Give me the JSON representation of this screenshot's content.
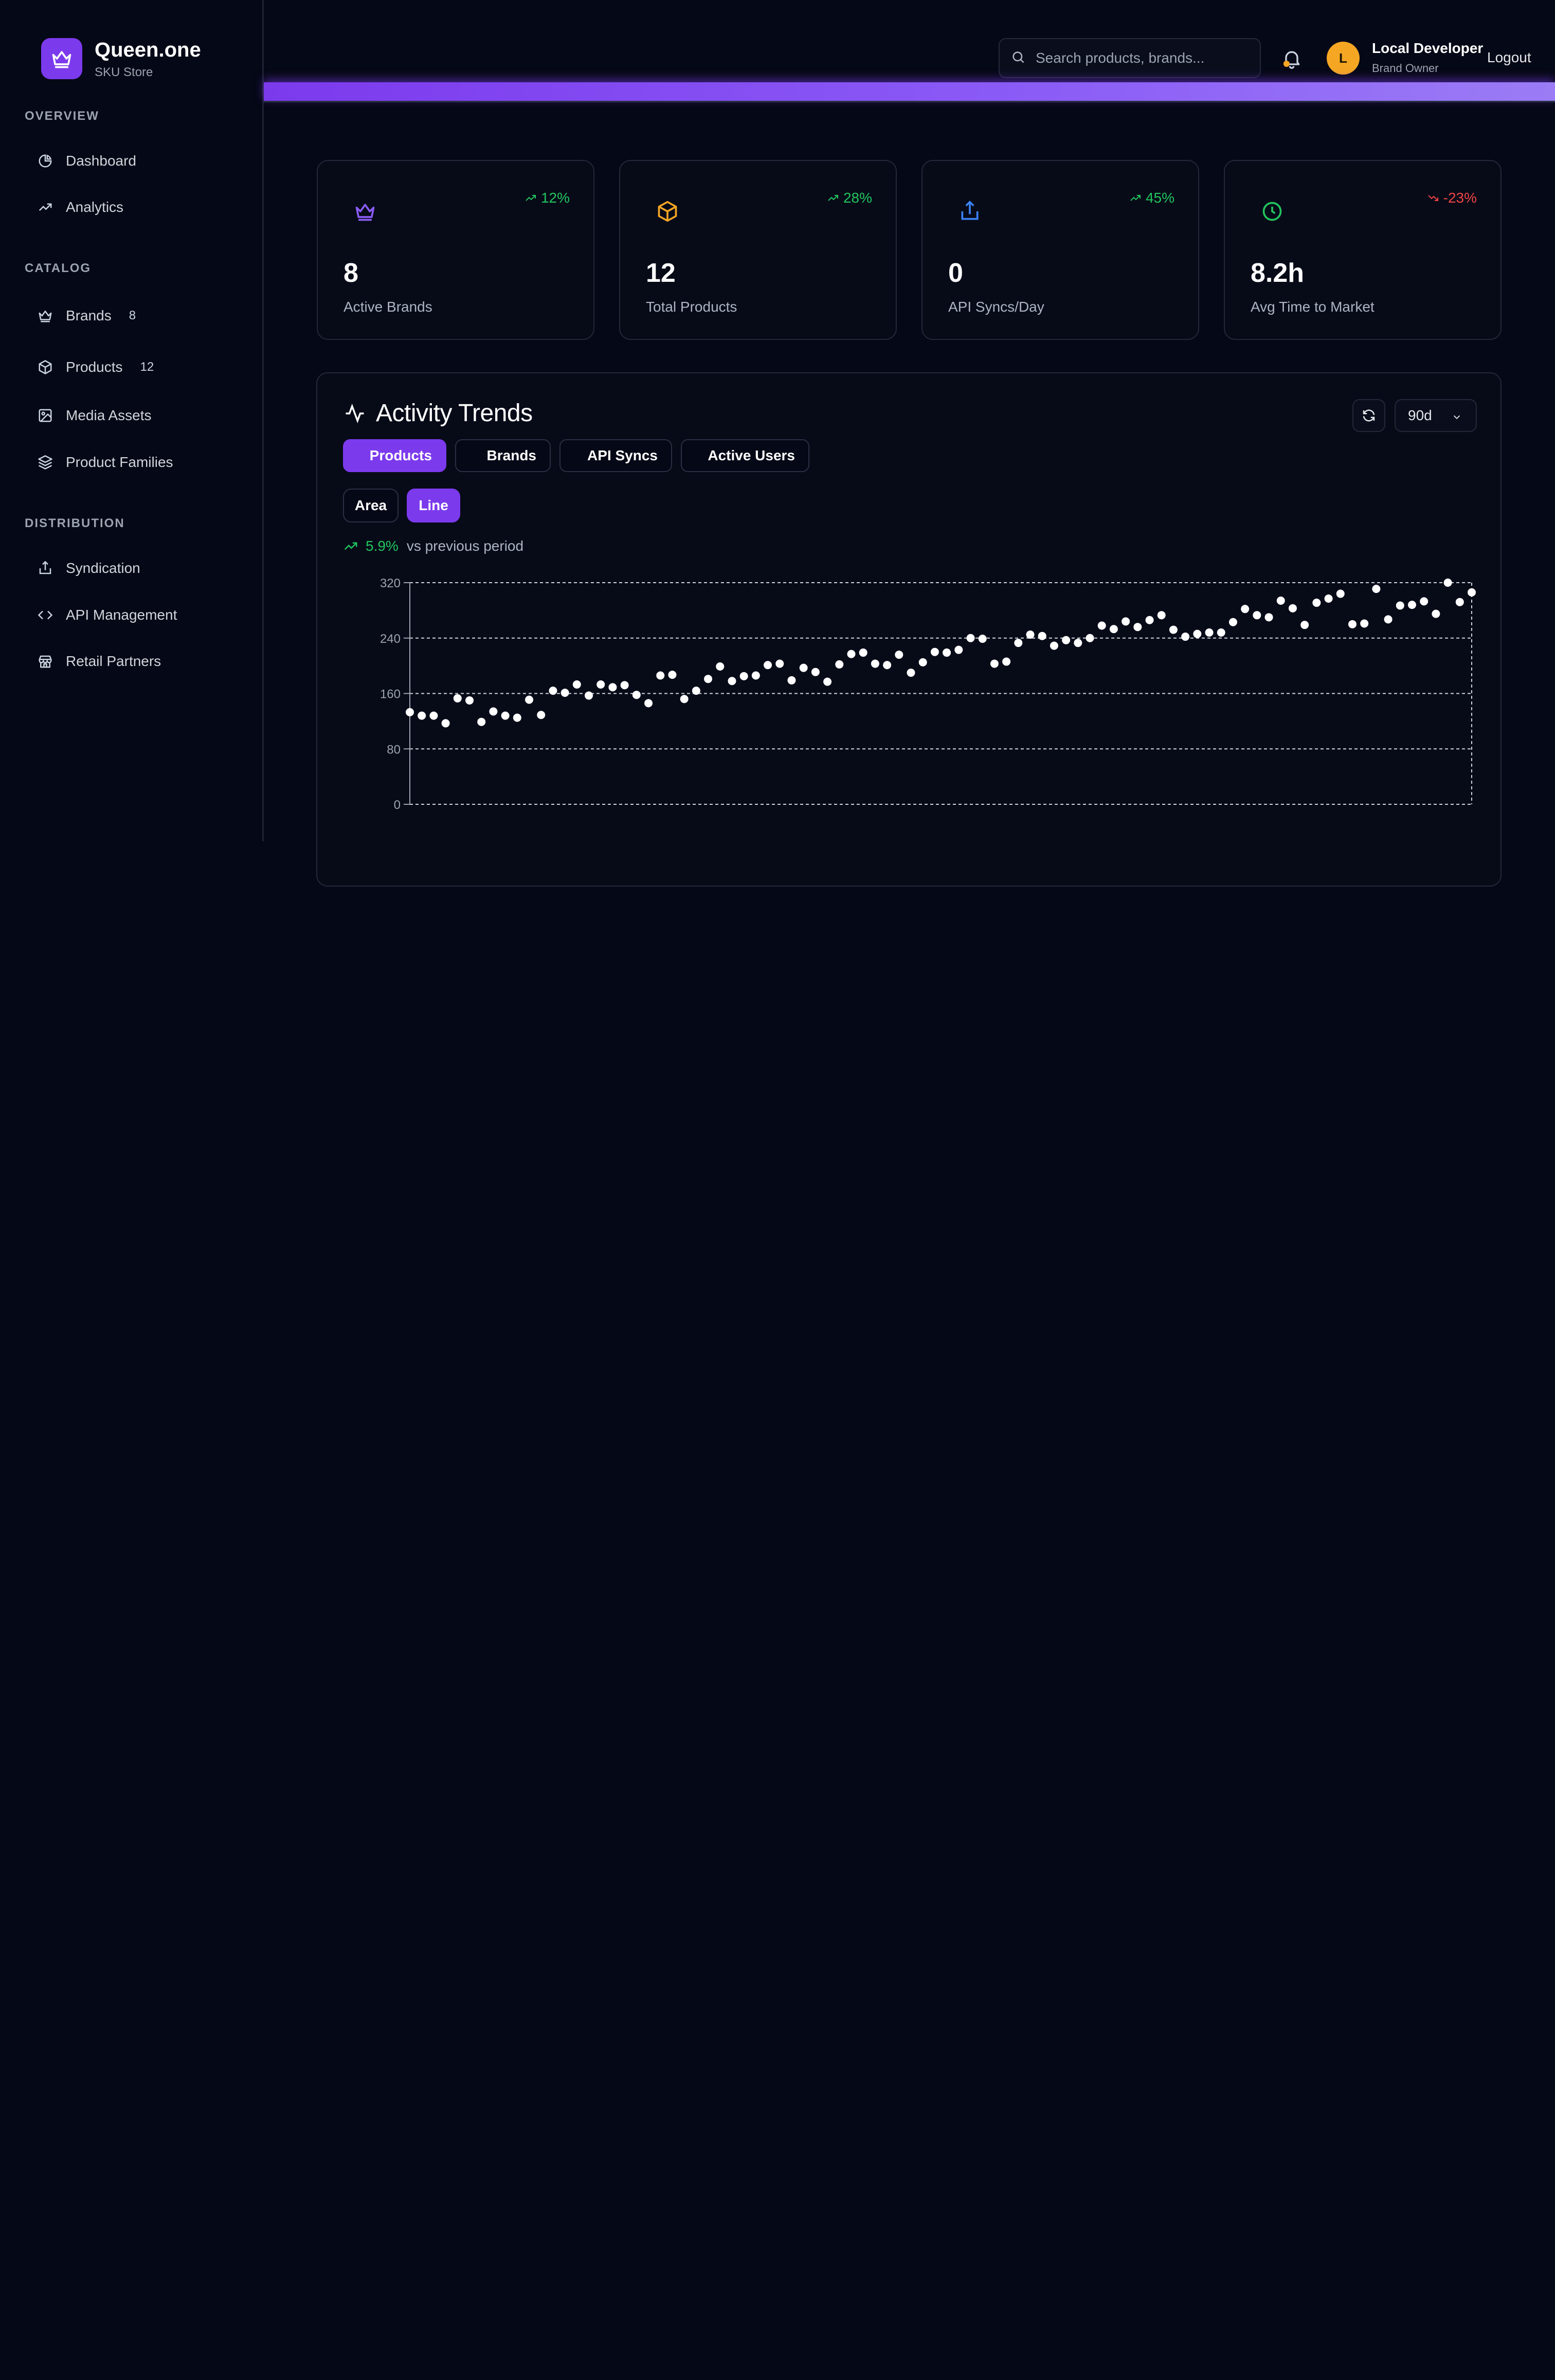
{
  "app": {
    "name": "Queen.one",
    "subtitle": "SKU Store"
  },
  "sidebar": {
    "sections": [
      {
        "label": "OVERVIEW",
        "items": [
          {
            "label": "Dashboard",
            "icon": "pie-chart-icon"
          },
          {
            "label": "Analytics",
            "icon": "trending-up-icon"
          }
        ]
      },
      {
        "label": "CATALOG",
        "items": [
          {
            "label": "Brands",
            "icon": "crown-icon",
            "count": "8"
          },
          {
            "label": "Products",
            "icon": "box-icon",
            "count": "12"
          },
          {
            "label": "Media Assets",
            "icon": "image-icon"
          },
          {
            "label": "Product Families",
            "icon": "layers-icon"
          }
        ]
      },
      {
        "label": "DISTRIBUTION",
        "items": [
          {
            "label": "Syndication",
            "icon": "share-icon"
          },
          {
            "label": "API Management",
            "icon": "code-icon"
          },
          {
            "label": "Retail Partners",
            "icon": "store-icon"
          }
        ]
      }
    ]
  },
  "header": {
    "search_placeholder": "Search products, brands...",
    "user": {
      "initial": "L",
      "name": "Local Developer",
      "role": "Brand Owner"
    },
    "logout_label": "Logout"
  },
  "colors": {
    "accent": "#7c3aed",
    "positive": "#22c55e",
    "negative": "#ef4444",
    "brands_icon": "#8b5cf6",
    "products_icon": "#f5a623",
    "syncs_icon": "#3b82f6",
    "time_icon": "#22c55e"
  },
  "stats": [
    {
      "value": "8",
      "label": "Active Brands",
      "trend": "12%",
      "direction": "up",
      "icon": "crown-icon"
    },
    {
      "value": "12",
      "label": "Total Products",
      "trend": "28%",
      "direction": "up",
      "icon": "box-icon"
    },
    {
      "value": "0",
      "label": "API Syncs/Day",
      "trend": "45%",
      "direction": "up",
      "icon": "share-icon"
    },
    {
      "value": "8.2h",
      "label": "Avg Time to Market",
      "trend": "-23%",
      "direction": "down",
      "icon": "clock-icon"
    }
  ],
  "activity": {
    "title": "Activity Trends",
    "range": "90d",
    "tabs": [
      "Products",
      "Brands",
      "API Syncs",
      "Active Users"
    ],
    "active_tab": "Products",
    "modes": [
      "Area",
      "Line"
    ],
    "active_mode": "Line",
    "delta_pct": "5.9%",
    "delta_text": "vs previous period"
  },
  "chart_data": {
    "type": "scatter",
    "title": "",
    "xlabel": "",
    "ylabel": "",
    "ylim": [
      0,
      320
    ],
    "yticks": [
      "0",
      "80",
      "160",
      "240",
      "320"
    ],
    "grid": true,
    "series": [
      {
        "values": [
          133,
          128,
          128,
          117,
          153,
          150,
          119,
          134,
          128,
          125,
          151,
          129,
          164,
          161,
          173,
          157,
          173,
          169,
          172,
          158,
          146,
          186,
          187,
          152,
          164,
          181,
          199,
          178,
          185,
          186,
          201,
          203,
          179,
          197,
          191,
          177,
          202,
          217,
          219,
          203,
          201,
          216,
          190,
          205,
          220,
          219,
          223,
          240,
          239,
          203,
          206,
          233,
          245,
          243,
          229,
          237,
          233,
          240,
          258,
          253,
          264,
          256,
          266,
          273,
          252,
          242,
          246,
          248,
          248,
          263,
          282,
          273,
          270,
          294,
          283,
          259,
          291,
          297,
          304,
          260,
          261,
          311,
          267,
          287,
          288,
          293,
          275,
          320,
          292,
          306
        ]
      }
    ]
  }
}
